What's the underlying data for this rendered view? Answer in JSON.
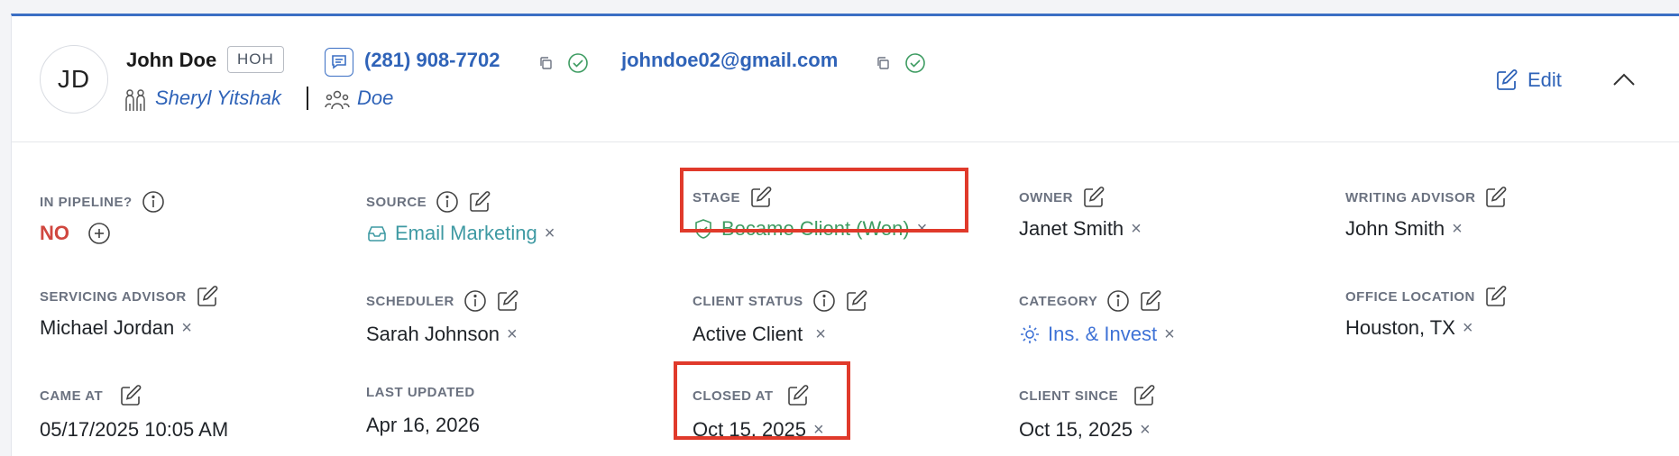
{
  "header": {
    "avatar_initials": "JD",
    "name": "John Doe",
    "badge": "HOH",
    "phone": "(281) 908-7702",
    "email": "johndoe02@gmail.com",
    "relation_person": "Sheryl Yitshak",
    "household": "Doe",
    "edit_label": "Edit"
  },
  "fields": {
    "in_pipeline": {
      "label": "IN PIPELINE?",
      "value": "NO"
    },
    "source": {
      "label": "SOURCE",
      "value": "Email Marketing",
      "icon": "inbox-icon"
    },
    "stage": {
      "label": "STAGE",
      "value": "Became Client (Won)",
      "icon": "shield-check-icon"
    },
    "owner": {
      "label": "OWNER",
      "value": "Janet Smith"
    },
    "writing_advisor": {
      "label": "WRITING ADVISOR",
      "value": "John Smith"
    },
    "servicing_advisor": {
      "label": "SERVICING ADVISOR",
      "value": "Michael Jordan"
    },
    "scheduler": {
      "label": "SCHEDULER",
      "value": "Sarah Johnson"
    },
    "client_status": {
      "label": "CLIENT STATUS",
      "value": "Active Client"
    },
    "category": {
      "label": "CATEGORY",
      "value": "Ins. & Invest",
      "icon": "sun-icon"
    },
    "office_location": {
      "label": "OFFICE LOCATION",
      "value": "Houston, TX"
    },
    "came_at": {
      "label": "CAME AT",
      "value": "05/17/2025 10:05 AM"
    },
    "last_updated": {
      "label": "LAST UPDATED",
      "value": "Apr 16, 2026"
    },
    "closed_at": {
      "label": "CLOSED AT",
      "value": "Oct 15, 2025"
    },
    "client_since": {
      "label": "CLIENT SINCE",
      "value": "Oct 15, 2025"
    }
  },
  "remove_glyph": "×",
  "colors": {
    "accent": "#2f63b8",
    "highlight": "#e03a2b",
    "no": "#d0473f",
    "stage": "#3e9c62",
    "source": "#3f9aa3",
    "category": "#3e72d6"
  }
}
